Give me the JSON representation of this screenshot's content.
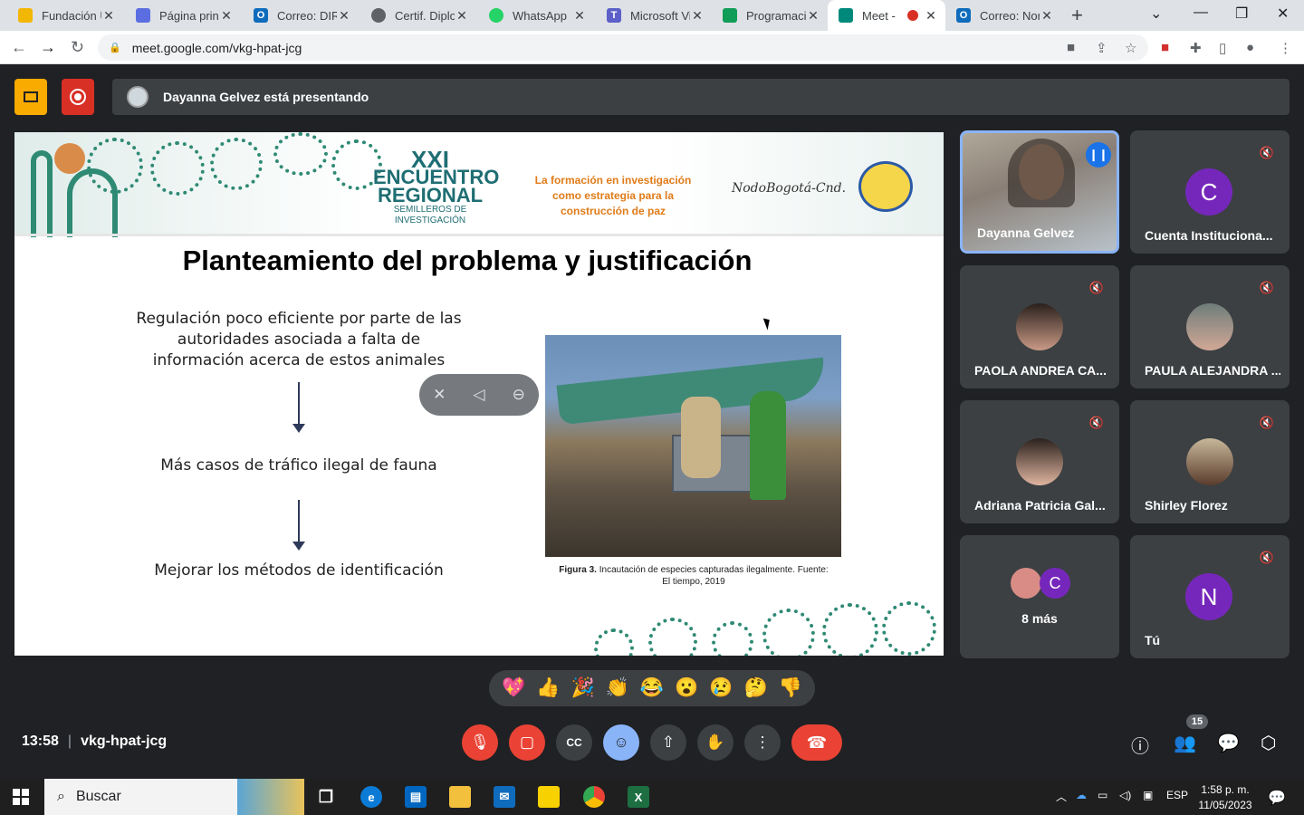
{
  "browser": {
    "tabs": [
      {
        "label": "Fundación U",
        "icon": "sunflower-icon",
        "color": "#f2b705"
      },
      {
        "label": "Página princ",
        "icon": "copilot-icon",
        "color": "#5b6ee1"
      },
      {
        "label": "Correo: DIR",
        "icon": "outlook-icon",
        "color": "#0f6cbd"
      },
      {
        "label": "Certif. Diplo",
        "icon": "globe-icon",
        "color": "#5f6368"
      },
      {
        "label": "WhatsApp",
        "icon": "whatsapp-icon",
        "color": "#25d366"
      },
      {
        "label": "Microsoft Vi",
        "icon": "teams-icon",
        "color": "#5b5fc7"
      },
      {
        "label": "Programacio",
        "icon": "sheets-icon",
        "color": "#0f9d58"
      },
      {
        "label": "Meet - ",
        "icon": "meet-icon",
        "color": "#00897b"
      },
      {
        "label": "Correo: Nor",
        "icon": "outlook-icon",
        "color": "#0f6cbd"
      }
    ],
    "url": "meet.google.com/vkg-hpat-jcg"
  },
  "meet": {
    "presenting": "Dayanna Gelvez está presentando",
    "slide": {
      "banner_title_1": "XXI",
      "banner_title_2": "ENCUENTRO",
      "banner_title_3": "REGIONAL",
      "banner_title_4": "SEMILLEROS DE INVESTIGACIÓN",
      "banner_slogan": "La formación en investigación como estrategia para la construcción de paz",
      "banner_logo": "NodoBogotá-Cnd.",
      "title": "Planteamiento del problema y justificación",
      "point_1": "Regulación poco eficiente por parte de las autoridades asociada a falta de información acerca de estos animales",
      "point_2": "Más casos de tráfico ilegal de fauna",
      "point_3": "Mejorar los métodos de identificación",
      "caption_bold": "Figura 3.",
      "caption_text": "Incautación de especies capturadas ilegalmente. Fuente: El tiempo, 2019"
    },
    "participants": [
      {
        "name": "Dayanna Gelvez",
        "type": "video"
      },
      {
        "name": "Cuenta Instituciona...",
        "initial": "C",
        "color": "#7627bb"
      },
      {
        "name": "PAOLA ANDREA CA...",
        "type": "photo"
      },
      {
        "name": "PAULA ALEJANDRA ...",
        "type": "photo"
      },
      {
        "name": "Adriana Patricia Gal...",
        "type": "photo"
      },
      {
        "name": "Shirley Florez",
        "type": "photo"
      },
      {
        "name": "8 más",
        "initial": "C",
        "color": "#7627bb"
      },
      {
        "name": "Tú",
        "initial": "N",
        "color": "#7627bb"
      }
    ],
    "reactions": [
      "💖",
      "👍",
      "🎉",
      "👏",
      "😂",
      "😮",
      "😢",
      "🤔",
      "👎"
    ],
    "time": "13:58",
    "meeting_code": "vkg-hpat-jcg",
    "people_count": "15"
  },
  "taskbar": {
    "search_placeholder": "Buscar",
    "lang": "ESP",
    "time": "1:58 p. m.",
    "date": "11/05/2023"
  }
}
